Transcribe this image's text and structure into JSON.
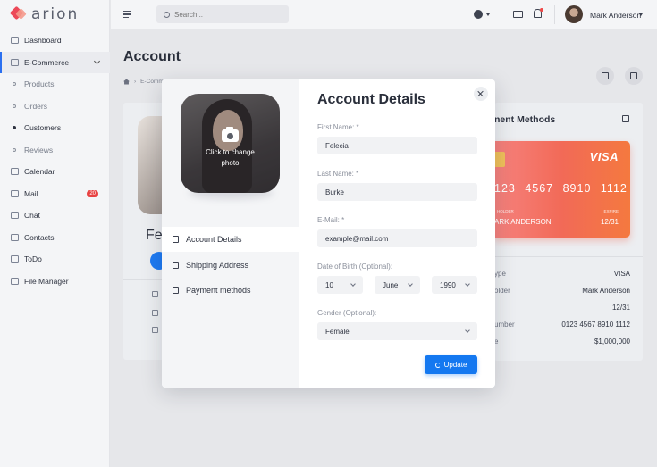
{
  "app": {
    "logo_text": "arion"
  },
  "search": {
    "placeholder": "Search..."
  },
  "user": {
    "name": "Mark Anderson"
  },
  "sidebar": {
    "items": [
      {
        "label": "Dashboard",
        "icon": "dashboard-icon"
      },
      {
        "label": "E-Commerce",
        "icon": "basket-icon"
      },
      {
        "label": "Products"
      },
      {
        "label": "Orders"
      },
      {
        "label": "Customers"
      },
      {
        "label": "Reviews"
      },
      {
        "label": "Calendar",
        "icon": "calendar-icon"
      },
      {
        "label": "Mail",
        "icon": "mail-icon",
        "badge": "20"
      },
      {
        "label": "Chat",
        "icon": "chat-icon"
      },
      {
        "label": "Contacts",
        "icon": "contacts-icon"
      },
      {
        "label": "ToDo",
        "icon": "todo-icon"
      },
      {
        "label": "File Manager",
        "icon": "folder-icon"
      }
    ]
  },
  "page": {
    "title": "Account",
    "breadcrumb": "E-Comm",
    "profile_name_partial": "Fel"
  },
  "payment": {
    "title_partial": "nent Methods",
    "card": {
      "brand": "VISA",
      "number_partial": "123 4567 8910 1112",
      "holder_label": "HOLDER",
      "holder": "ARK ANDERSON",
      "expire_label": "EXPIRE",
      "expire": "12/31"
    },
    "details": [
      {
        "label": "ype",
        "value": "VISA"
      },
      {
        "label": "older",
        "value": "Mark Anderson"
      },
      {
        "label": "",
        "value": "12/31"
      },
      {
        "label": "umber",
        "value": "0123 4567 8910 1112"
      },
      {
        "label": "e",
        "value": "$1,000,000"
      }
    ]
  },
  "modal": {
    "title": "Account Details",
    "photo_caption": "Click to change photo",
    "tabs": [
      {
        "label": "Account Details",
        "icon": "document-icon"
      },
      {
        "label": "Shipping Address",
        "icon": "truck-icon"
      },
      {
        "label": "Payment methods",
        "icon": "credit-card-icon"
      }
    ],
    "fields": {
      "first_name": {
        "label": "First Name: *",
        "value": "Felecia"
      },
      "last_name": {
        "label": "Last Name: *",
        "value": "Burke"
      },
      "email": {
        "label": "E-Mail: *",
        "value": "example@mail.com"
      },
      "dob": {
        "label": "Date of Birth (Optional):",
        "day": "10",
        "month": "June",
        "year": "1990"
      },
      "gender": {
        "label": "Gender (Optional):",
        "value": "Female"
      }
    },
    "update_label": "Update"
  },
  "colors": {
    "accent": "#1478f0",
    "brand": "#ec4958",
    "card_gradient_start": "#f6827e",
    "card_gradient_end": "#f4793f"
  }
}
